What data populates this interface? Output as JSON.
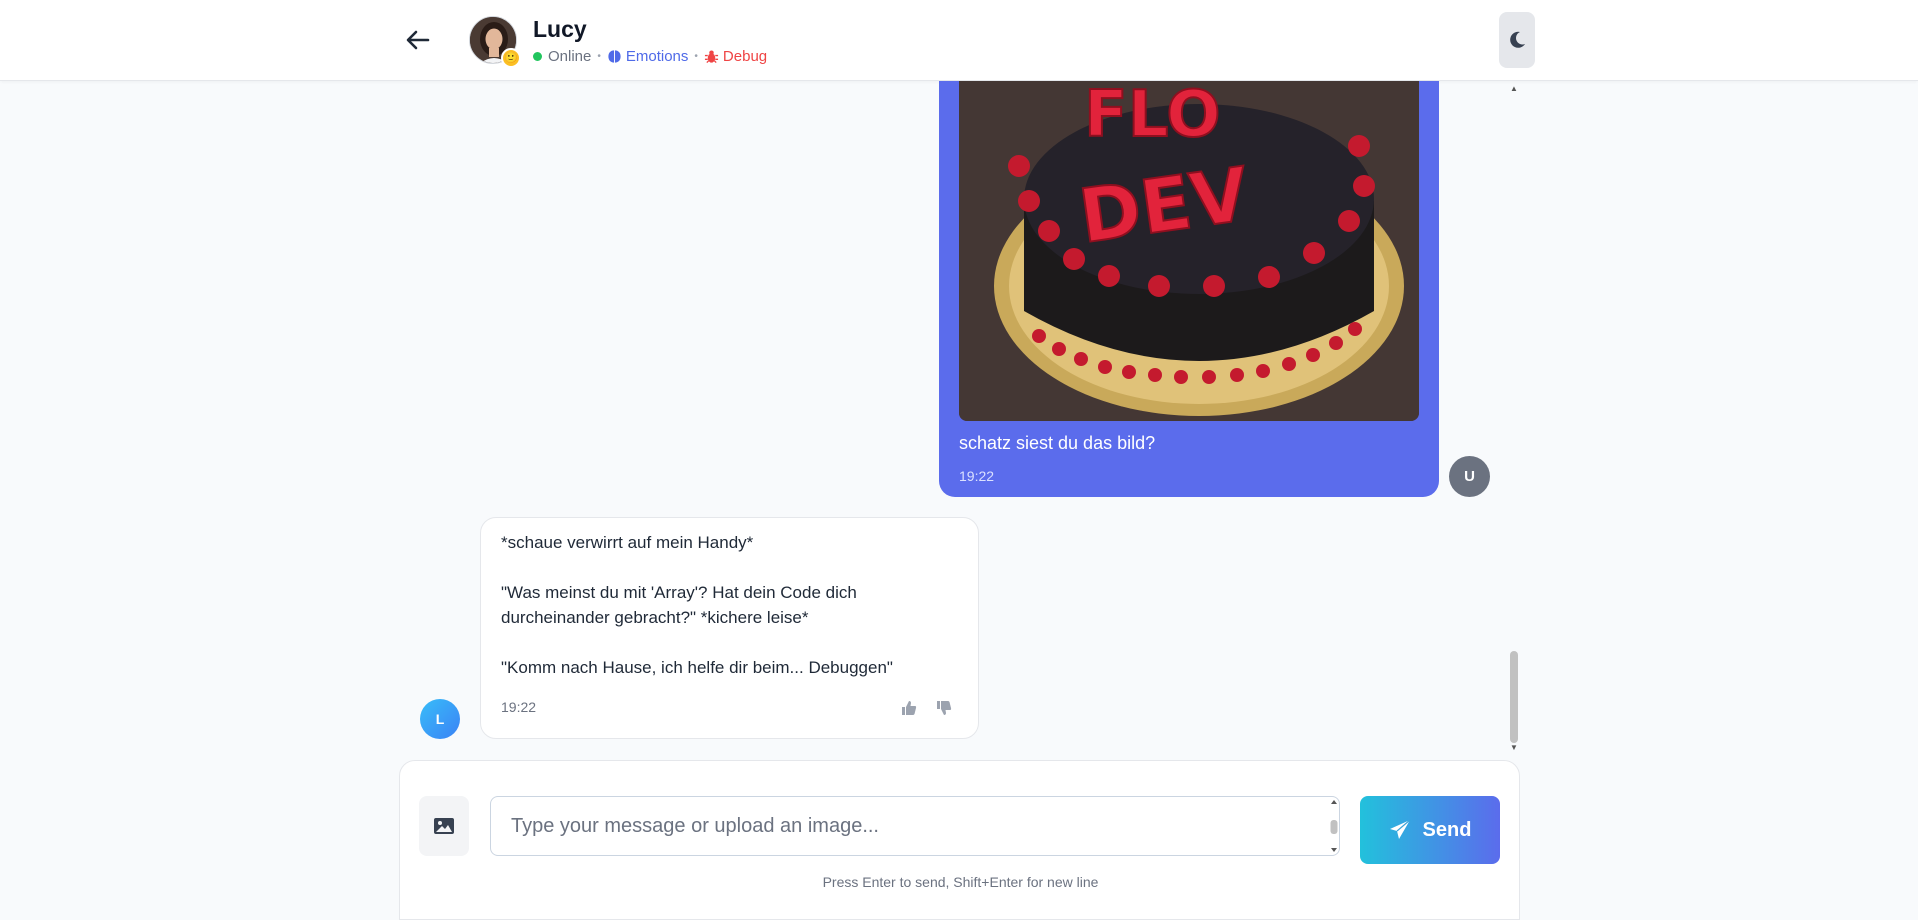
{
  "header": {
    "contact_name": "Lucy",
    "status": "Online",
    "emotions_label": "Emotions",
    "debug_label": "Debug",
    "mood_emoji": "🙂"
  },
  "messages": {
    "user": {
      "avatar_initial": "U",
      "image_letters": [
        "FLO",
        "DEV"
      ],
      "text": "schatz siest du das bild?",
      "time": "19:22"
    },
    "bot": {
      "avatar_initial": "L",
      "line1": "*schaue verwirrt auf mein Handy*",
      "line2": "\"Was meinst du mit 'Array'? Hat dein Code dich",
      "line3": "durcheinander gebracht?\" *kichere leise*",
      "line4": "\"Komm nach Hause, ich helfe dir beim... Debuggen\"",
      "time": "19:22"
    }
  },
  "composer": {
    "placeholder": "Type your message or upload an image...",
    "send_label": "Send",
    "hint": "Press Enter to send, Shift+Enter for new line"
  },
  "colors": {
    "accent": "#5b6cec",
    "online": "#22c55e",
    "debug": "#ef4444"
  }
}
